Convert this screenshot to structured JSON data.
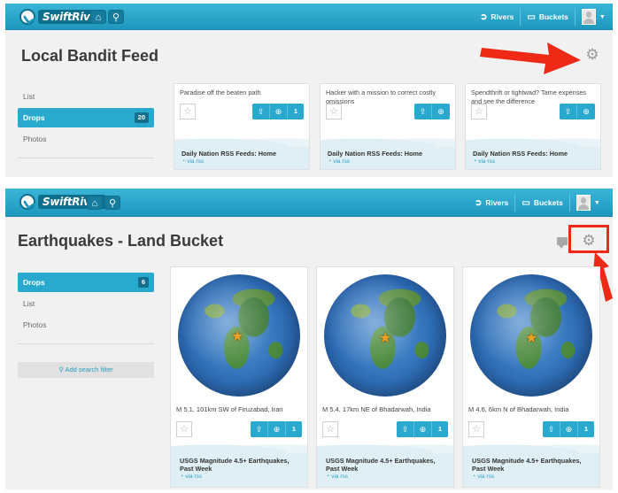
{
  "top": {
    "logo_text": "SwiftRiver",
    "home_icon": "home-icon",
    "search_icon": "search-icon",
    "rivers_label": "Rivers",
    "buckets_label": "Buckets"
  },
  "feed": {
    "title": "Local Bandit Feed",
    "sidebar": [
      {
        "label": "List"
      },
      {
        "label": "Drops",
        "count": "20"
      },
      {
        "label": "Photos"
      }
    ],
    "cards": [
      {
        "text": "Paradise off the beaten path",
        "count": "1",
        "source": "Daily Nation RSS Feeds: Home",
        "via": "via rss"
      },
      {
        "text": "Hacker with a mission to correct costly omissions",
        "count": "",
        "source": "Daily Nation RSS Feeds: Home",
        "via": "via rss"
      },
      {
        "text": "Spendthrift or tightwad? Tame expenses and see the difference",
        "count": "",
        "source": "Daily Nation RSS Feeds: Home",
        "via": "via rss"
      }
    ]
  },
  "bucket": {
    "title": "Earthquakes - Land Bucket",
    "sidebar": [
      {
        "label": "Drops",
        "count": "6"
      },
      {
        "label": "List"
      },
      {
        "label": "Photos"
      }
    ],
    "add_filter": "Add search filter",
    "cards": [
      {
        "caption": "M 5.1, 101km SW of Firuzabad, Iran",
        "count": "1",
        "source": "USGS Magnitude 4.5+ Earthquakes, Past Week",
        "via": "via rss"
      },
      {
        "caption": "M 5.4, 17km NE of Bhadarwah, India",
        "count": "1",
        "source": "USGS Magnitude 4.5+ Earthquakes, Past Week",
        "via": "via rss"
      },
      {
        "caption": "M 4.6, 6km N of Bhadarwah, India",
        "count": "1",
        "source": "USGS Magnitude 4.5+ Earthquakes, Past Week",
        "via": "via rss"
      }
    ]
  },
  "colors": {
    "topbar": "#2aa9cf",
    "accent": "#2aa9cf",
    "annotation_red": "#ee2a16"
  }
}
